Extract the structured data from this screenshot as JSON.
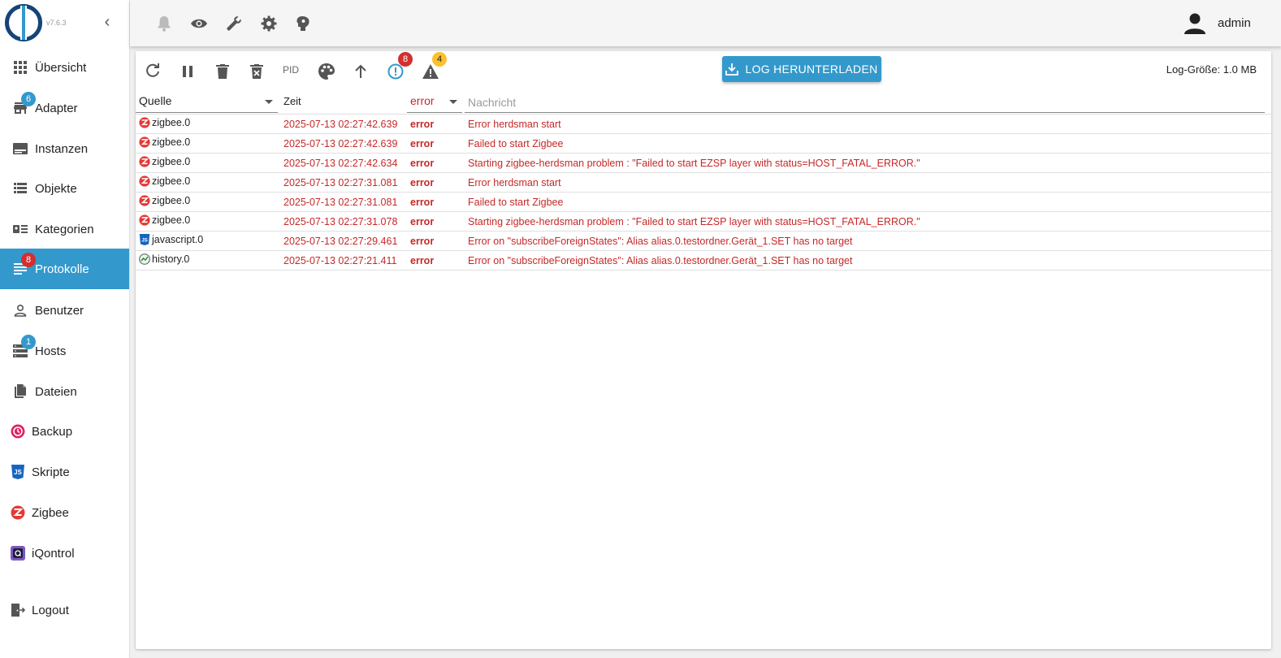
{
  "app": {
    "version": "v7.6.3"
  },
  "sidebar": {
    "items": [
      {
        "label": "Übersicht",
        "icon": "apps-grid-icon",
        "badge": null
      },
      {
        "label": "Adapter",
        "icon": "store-icon",
        "badge": "6"
      },
      {
        "label": "Instanzen",
        "icon": "instances-icon",
        "badge": null
      },
      {
        "label": "Objekte",
        "icon": "list-icon",
        "badge": null
      },
      {
        "label": "Kategorien",
        "icon": "categories-icon",
        "badge": null
      },
      {
        "label": "Protokolle",
        "icon": "logs-icon",
        "badge": "8"
      },
      {
        "label": "Benutzer",
        "icon": "user-icon",
        "badge": null
      },
      {
        "label": "Hosts",
        "icon": "storage-icon",
        "badge": "1"
      },
      {
        "label": "Dateien",
        "icon": "files-icon",
        "badge": null
      },
      {
        "label": "Backup",
        "icon": "backup-icon",
        "badge": null
      },
      {
        "label": "Skripte",
        "icon": "javascript-icon",
        "badge": null
      },
      {
        "label": "Zigbee",
        "icon": "zigbee-icon",
        "badge": null
      },
      {
        "label": "iQontrol",
        "icon": "iqontrol-icon",
        "badge": null
      },
      {
        "label": "Logout",
        "icon": "logout-icon",
        "badge": null
      }
    ]
  },
  "topbar": {
    "icons": [
      "bell-icon",
      "eye-icon",
      "wrench-icon",
      "gear-icon",
      "expert-mode-icon"
    ],
    "user": "admin"
  },
  "toolbar": {
    "pid_label": "PID",
    "error_count": "8",
    "warning_count": "4",
    "download_label": "LOG HERUNTERLADEN",
    "log_size": "Log-Größe: 1.0 MB"
  },
  "filters": {
    "source": "Quelle",
    "time_header": "Zeit",
    "severity": "error",
    "message_placeholder": "Nachricht"
  },
  "colors": {
    "accent": "#3399cc",
    "error": "#c62828",
    "warning_badge": "#fbc02d",
    "error_badge": "#d32f2f"
  },
  "logs": [
    {
      "source": "zigbee.0",
      "icon": "zigbee-icon",
      "time": "2025-07-13 02:27:42.639",
      "severity": "error",
      "message": "Error herdsman start"
    },
    {
      "source": "zigbee.0",
      "icon": "zigbee-icon",
      "time": "2025-07-13 02:27:42.639",
      "severity": "error",
      "message": "Failed to start Zigbee"
    },
    {
      "source": "zigbee.0",
      "icon": "zigbee-icon",
      "time": "2025-07-13 02:27:42.634",
      "severity": "error",
      "message": "Starting zigbee-herdsman problem : \"Failed to start EZSP layer with status=HOST_FATAL_ERROR.\""
    },
    {
      "source": "zigbee.0",
      "icon": "zigbee-icon",
      "time": "2025-07-13 02:27:31.081",
      "severity": "error",
      "message": "Error herdsman start"
    },
    {
      "source": "zigbee.0",
      "icon": "zigbee-icon",
      "time": "2025-07-13 02:27:31.081",
      "severity": "error",
      "message": "Failed to start Zigbee"
    },
    {
      "source": "zigbee.0",
      "icon": "zigbee-icon",
      "time": "2025-07-13 02:27:31.078",
      "severity": "error",
      "message": "Starting zigbee-herdsman problem : \"Failed to start EZSP layer with status=HOST_FATAL_ERROR.\""
    },
    {
      "source": "javascript.0",
      "icon": "javascript-icon",
      "time": "2025-07-13 02:27:29.461",
      "severity": "error",
      "message": "Error on \"subscribeForeignStates\": Alias alias.0.testordner.Gerät_1.SET has no target"
    },
    {
      "source": "history.0",
      "icon": "history-icon",
      "time": "2025-07-13 02:27:21.411",
      "severity": "error",
      "message": "Error on \"subscribeForeignStates\": Alias alias.0.testordner.Gerät_1.SET has no target"
    }
  ]
}
